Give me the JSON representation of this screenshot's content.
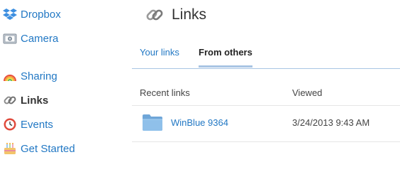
{
  "sidebar": {
    "items": [
      {
        "label": "Dropbox",
        "icon": "dropbox-icon"
      },
      {
        "label": "Camera",
        "icon": "camera-icon"
      },
      {
        "label": "Sharing",
        "icon": "rainbow-icon"
      },
      {
        "label": "Links",
        "icon": "chain-link-icon",
        "active": true
      },
      {
        "label": "Events",
        "icon": "clock-icon"
      },
      {
        "label": "Get Started",
        "icon": "cake-icon"
      }
    ]
  },
  "page": {
    "title": "Links",
    "icon": "chain-link-icon"
  },
  "tabs": [
    {
      "label": "Your links",
      "active": false
    },
    {
      "label": "From others",
      "active": true
    }
  ],
  "table": {
    "headers": [
      "Recent links",
      "Viewed"
    ],
    "rows": [
      {
        "name": "WinBlue 9364",
        "viewed": "3/24/2013 9:43 AM",
        "icon": "folder-icon"
      }
    ]
  },
  "colors": {
    "link": "#2278c4",
    "tab_underline": "#a9c5e4",
    "text": "#333333"
  }
}
